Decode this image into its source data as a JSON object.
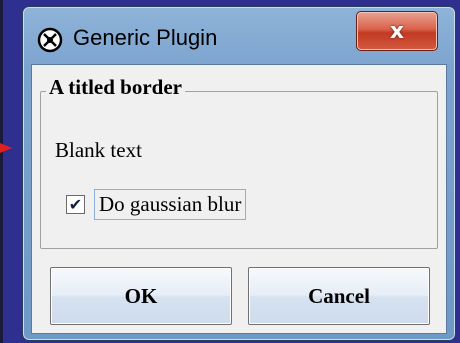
{
  "window": {
    "title": "Generic Plugin",
    "close_glyph": "x"
  },
  "panel": {
    "border_title": "A titled border",
    "text": "Blank text",
    "checkbox": {
      "label": "Do gaussian blur",
      "checked": true,
      "check_glyph": "✔"
    }
  },
  "buttons": {
    "ok": "OK",
    "cancel": "Cancel"
  },
  "colors": {
    "background": "#2f2f8f",
    "close_button": "#c23a22",
    "pointer_arrow": "#e02020"
  },
  "icons": [
    "app-icon",
    "close-icon",
    "checkmark-icon",
    "pointer-arrow-icon"
  ]
}
